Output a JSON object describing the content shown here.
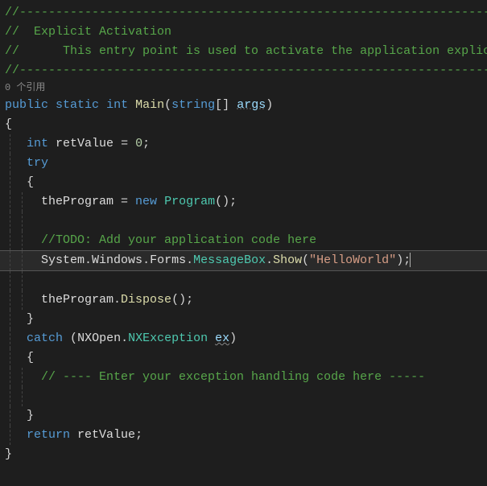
{
  "comments": {
    "divider": "//------------------------------------------------------------------------------",
    "title": "//  Explicit Activation",
    "subtitle": "//      This entry point is used to activate the application explicitly",
    "todo": "//TODO: Add your application code here",
    "catch_comment": "// ---- Enter your exception handling code here -----"
  },
  "codelens": {
    "references": "0 个引用"
  },
  "tokens": {
    "public": "public",
    "static": "static",
    "int": "int",
    "Main": "Main",
    "string_arr": "string",
    "args": "args",
    "retValue_decl": "retValue",
    "zero": "0",
    "try": "try",
    "theProgram": "theProgram",
    "new": "new",
    "Program": "Program",
    "System": "System",
    "Windows": "Windows",
    "Forms": "Forms",
    "MessageBox": "MessageBox",
    "Show": "Show",
    "hello": "\"HelloWorld\"",
    "Dispose": "Dispose",
    "catch": "catch",
    "NXOpen": "NXOpen",
    "NXException": "NXException",
    "ex": "ex",
    "return": "return",
    "retValue_ret": "retValue"
  },
  "punct": {
    "lbrace": "{",
    "rbrace": "}",
    "lparen": "(",
    "rparen": ")",
    "lbracket": "[",
    "rbracket": "]",
    "semi": ";",
    "dot": ".",
    "eq": " = ",
    "space": " "
  }
}
